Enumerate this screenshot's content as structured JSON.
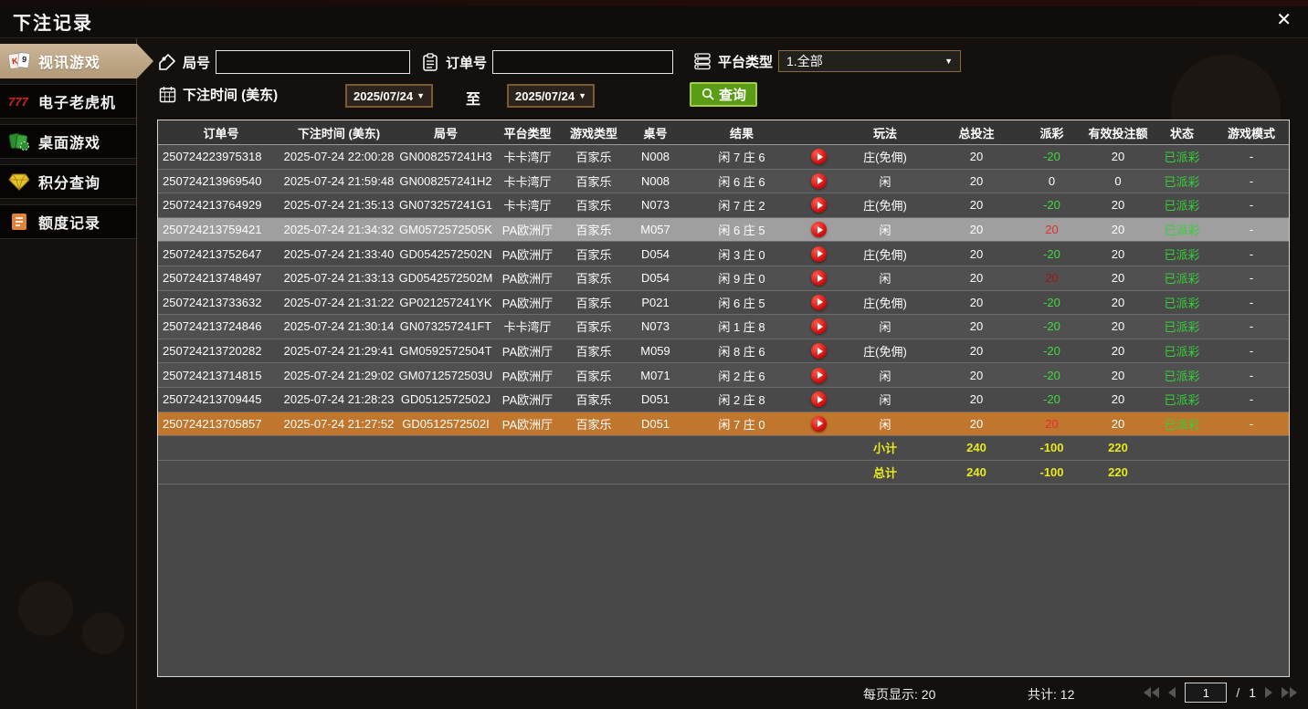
{
  "window": {
    "title": "下注记录",
    "close_glyph": "✕"
  },
  "sidebar": {
    "items": [
      {
        "label": "视讯游戏",
        "icon": "playing-cards-icon",
        "active": true
      },
      {
        "label": "电子老虎机",
        "icon": "slot-777-icon",
        "active": false
      },
      {
        "label": "桌面游戏",
        "icon": "table-games-icon",
        "active": false
      },
      {
        "label": "积分查询",
        "icon": "diamond-icon",
        "active": false
      },
      {
        "label": "额度记录",
        "icon": "document-icon",
        "active": false
      }
    ]
  },
  "filters": {
    "round_label": "局号",
    "round_value": "",
    "order_label": "订单号",
    "order_value": "",
    "platform_label": "平台类型",
    "platform_value": "1.全部",
    "time_label": "下注时间 (美东)",
    "date_from": "2025/07/24",
    "to_label": "至",
    "date_to": "2025/07/24",
    "query_label": "查询"
  },
  "table": {
    "columns": [
      "订单号",
      "下注时间 (美东)",
      "局号",
      "平台类型",
      "游戏类型",
      "桌号",
      "结果",
      "",
      "玩法",
      "总投注",
      "派彩",
      "有效投注额",
      "状态",
      "游戏模式"
    ],
    "rows": [
      {
        "order": "250724223975318",
        "time": "2025-07-24 22:00:28",
        "round": "GN008257241H3",
        "platform": "卡卡湾厅",
        "game": "百家乐",
        "table": "N008",
        "result": "闲 7 庄 6",
        "play": "庄(免佣)",
        "bet": "20",
        "payout": "-20",
        "payout_tone": "neg",
        "valid": "20",
        "status": "已派彩",
        "mode": "-",
        "state": "normal"
      },
      {
        "order": "250724213969540",
        "time": "2025-07-24 21:59:48",
        "round": "GN008257241H2",
        "platform": "卡卡湾厅",
        "game": "百家乐",
        "table": "N008",
        "result": "闲 6 庄 6",
        "play": "闲",
        "bet": "20",
        "payout": "0",
        "payout_tone": "zero",
        "valid": "0",
        "status": "已派彩",
        "mode": "-",
        "state": "normal"
      },
      {
        "order": "250724213764929",
        "time": "2025-07-24 21:35:13",
        "round": "GN073257241G1",
        "platform": "卡卡湾厅",
        "game": "百家乐",
        "table": "N073",
        "result": "闲 7 庄 2",
        "play": "庄(免佣)",
        "bet": "20",
        "payout": "-20",
        "payout_tone": "neg",
        "valid": "20",
        "status": "已派彩",
        "mode": "-",
        "state": "normal"
      },
      {
        "order": "250724213759421",
        "time": "2025-07-24 21:34:32",
        "round": "GM0572572505K",
        "platform": "PA欧洲厅",
        "game": "百家乐",
        "table": "M057",
        "result": "闲 6 庄 5",
        "play": "闲",
        "bet": "20",
        "payout": "20",
        "payout_tone": "pos",
        "valid": "20",
        "status": "已派彩",
        "mode": "-",
        "state": "selected"
      },
      {
        "order": "250724213752647",
        "time": "2025-07-24 21:33:40",
        "round": "GD0542572502N",
        "platform": "PA欧洲厅",
        "game": "百家乐",
        "table": "D054",
        "result": "闲 3 庄 0",
        "play": "庄(免佣)",
        "bet": "20",
        "payout": "-20",
        "payout_tone": "neg",
        "valid": "20",
        "status": "已派彩",
        "mode": "-",
        "state": "normal"
      },
      {
        "order": "250724213748497",
        "time": "2025-07-24 21:33:13",
        "round": "GD0542572502M",
        "platform": "PA欧洲厅",
        "game": "百家乐",
        "table": "D054",
        "result": "闲 9 庄 0",
        "play": "闲",
        "bet": "20",
        "payout": "20",
        "payout_tone": "pos_dark",
        "valid": "20",
        "status": "已派彩",
        "mode": "-",
        "state": "normal"
      },
      {
        "order": "250724213733632",
        "time": "2025-07-24 21:31:22",
        "round": "GP021257241YK",
        "platform": "PA欧洲厅",
        "game": "百家乐",
        "table": "P021",
        "result": "闲 6 庄 5",
        "play": "庄(免佣)",
        "bet": "20",
        "payout": "-20",
        "payout_tone": "neg",
        "valid": "20",
        "status": "已派彩",
        "mode": "-",
        "state": "normal"
      },
      {
        "order": "250724213724846",
        "time": "2025-07-24 21:30:14",
        "round": "GN073257241FT",
        "platform": "卡卡湾厅",
        "game": "百家乐",
        "table": "N073",
        "result": "闲 1 庄 8",
        "play": "闲",
        "bet": "20",
        "payout": "-20",
        "payout_tone": "neg",
        "valid": "20",
        "status": "已派彩",
        "mode": "-",
        "state": "normal"
      },
      {
        "order": "250724213720282",
        "time": "2025-07-24 21:29:41",
        "round": "GM0592572504T",
        "platform": "PA欧洲厅",
        "game": "百家乐",
        "table": "M059",
        "result": "闲 8 庄 6",
        "play": "庄(免佣)",
        "bet": "20",
        "payout": "-20",
        "payout_tone": "neg",
        "valid": "20",
        "status": "已派彩",
        "mode": "-",
        "state": "normal"
      },
      {
        "order": "250724213714815",
        "time": "2025-07-24 21:29:02",
        "round": "GM0712572503U",
        "platform": "PA欧洲厅",
        "game": "百家乐",
        "table": "M071",
        "result": "闲 2 庄 6",
        "play": "闲",
        "bet": "20",
        "payout": "-20",
        "payout_tone": "neg",
        "valid": "20",
        "status": "已派彩",
        "mode": "-",
        "state": "normal"
      },
      {
        "order": "250724213709445",
        "time": "2025-07-24 21:28:23",
        "round": "GD0512572502J",
        "platform": "PA欧洲厅",
        "game": "百家乐",
        "table": "D051",
        "result": "闲 2 庄 8",
        "play": "闲",
        "bet": "20",
        "payout": "-20",
        "payout_tone": "neg",
        "valid": "20",
        "status": "已派彩",
        "mode": "-",
        "state": "normal"
      },
      {
        "order": "250724213705857",
        "time": "2025-07-24 21:27:52",
        "round": "GD0512572502I",
        "platform": "PA欧洲厅",
        "game": "百家乐",
        "table": "D051",
        "result": "闲 7 庄 0",
        "play": "闲",
        "bet": "20",
        "payout": "20",
        "payout_tone": "pos",
        "valid": "20",
        "status": "已派彩",
        "mode": "-",
        "state": "highlight"
      }
    ],
    "summary": [
      {
        "label": "小计",
        "bet": "240",
        "payout": "-100",
        "valid": "220"
      },
      {
        "label": "总计",
        "bet": "240",
        "payout": "-100",
        "valid": "220"
      }
    ]
  },
  "footer": {
    "per_page_label": "每页显示: 20",
    "total_label": "共计: 12",
    "page": "1",
    "page_sep": "/",
    "total_pages": "1"
  },
  "colors": {
    "header_gold": "#d9b869",
    "win_red": "#e03030",
    "loss_green": "#42d942",
    "status_green": "#36cf36",
    "summary_yellow": "#e9e920",
    "selected_row": "#9f9f9f",
    "highlight_row": "#c0762c",
    "query_green": "#5a9c14",
    "active_tab_tan": "#bfa888"
  }
}
